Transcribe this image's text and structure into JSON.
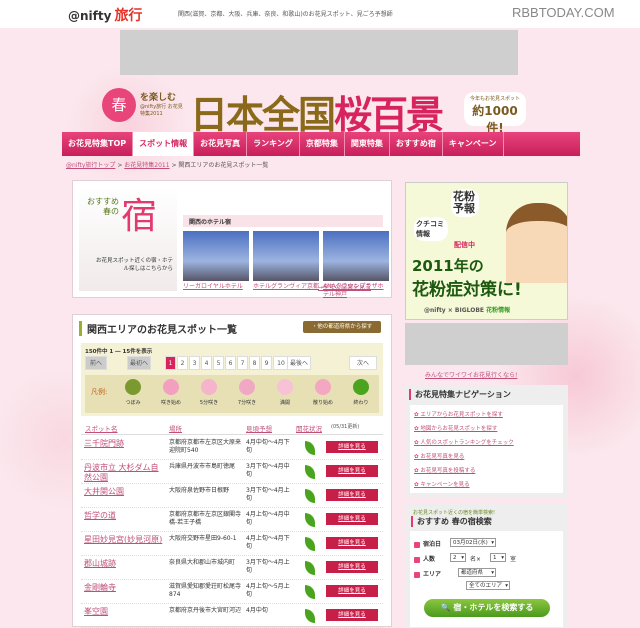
{
  "header": {
    "logo": "@nifty",
    "logo_sub": "旅行",
    "tagline": "関西(滋賀、京都、大阪、兵庫、奈良、和歌山)のお花見スポット、見ごろ予想師",
    "watermark": "RBBTODAY.COM"
  },
  "banner": {
    "flower": "春",
    "enjoy": "を楽しむ",
    "sub": "@nifty旅行 お花見特集2011",
    "title_a": "日本全国",
    "title_b": "桜百景",
    "count_small": "今年もお花見スポット",
    "count_big": "約1000件!"
  },
  "nav": [
    "お花見特集TOP",
    "スポット情報",
    "お花見写真",
    "ランキング",
    "京都特集",
    "関東特集",
    "おすすめ宿",
    "キャンペーン"
  ],
  "breadcrumb": {
    "items": [
      "@nifty旅行トップ",
      "お花見特集2011"
    ],
    "current": "関西エリアのお花見スポット一覧",
    "sep": ">"
  },
  "hotel": {
    "rec_a": "おすすめ春の",
    "rec_k": "宿",
    "rec_desc": "お花見スポット近くの宿・ホテル探しはこちらから",
    "heading": "関西のホテル宿",
    "cards": [
      "リーガロイヤルホテル",
      "ホテルグランヴィア京都",
      "ANAクラウンプラザホテル神戸"
    ],
    "all": "→全ての結果を見る"
  },
  "list": {
    "title": "関西エリアのお花見スポット一覧",
    "other": "・他の都道府県から探す",
    "count": "150件中 1 ― 15件を表示",
    "prev": "前へ",
    "first": "最初へ",
    "pages": [
      "1",
      "2",
      "3",
      "4",
      "5",
      "6",
      "7",
      "8",
      "9",
      "10"
    ],
    "last": "最後へ",
    "next": "次へ",
    "legend_label": "凡例:",
    "legend": [
      "つぼみ",
      "咲き始め",
      "5分咲き",
      "7分咲き",
      "満開",
      "散り始め",
      "終わり"
    ],
    "headers": [
      "スポット名",
      "場所",
      "見頃予想",
      "開花状況"
    ],
    "updated": "(05/31更新)",
    "detail": "詳細を見る",
    "rows": [
      {
        "name": "三千院門跡",
        "place": "京都府京都市左京区大原来迎院町540",
        "time": "4月中旬～4月下旬"
      },
      {
        "name": "丹波市立 大杉ダム自然公園",
        "place": "兵庫県丹波市市島町徳尾",
        "time": "3月下旬～4月中旬"
      },
      {
        "name": "大井関公園",
        "place": "大阪府泉佐野市日根野",
        "time": "3月下旬～4月上旬"
      },
      {
        "name": "哲学の道",
        "place": "京都府京都市左京区銀閣寺橋-若王子橋",
        "time": "4月上旬～4月中旬"
      },
      {
        "name": "星田妙見宮(妙見河原)",
        "place": "大阪府交野市星田9-60-1",
        "time": "4月上旬～4月下旬"
      },
      {
        "name": "郡山城跡",
        "place": "奈良県大和郡山市城内町",
        "time": "3月下旬～4月上旬"
      },
      {
        "name": "金剛輪寺",
        "place": "滋賀県愛知郡愛荘町松尾寺874",
        "time": "4月上旬～5月上旬"
      },
      {
        "name": "峯空園",
        "place": "京都府京丹後市大宮町河辺",
        "time": "4月中旬"
      }
    ]
  },
  "pollen": {
    "a": "花粉予報",
    "b": "クチコミ情報",
    "c": "配信中",
    "d": "2011年の",
    "e": "花粉症対策に!",
    "f1": "@nifty × BIGLOBE",
    "f2": "花粉情報"
  },
  "sidebar": {
    "wai": "みんなでワイワイお花見行くなら!",
    "navi_title": "お花見特集ナビゲーション",
    "navi": [
      "エリアからお花見スポットを探す",
      "地図からお花見スポットを探す",
      "人気のスポットランキングをチェック",
      "お花見写真を見る",
      "お花見写真を投稿する",
      "キャンペーンを見る"
    ],
    "search_sub": "お花見スポット近くの宿を簡単検索!",
    "search_title": "おすすめ 春の宿検索",
    "date_label": "宿泊日",
    "date": "03月02日(水)",
    "people_label": "人数",
    "people": "2",
    "people_unit": "名×",
    "rooms": "1",
    "rooms_unit": "室",
    "area_label": "エリア",
    "pref": "都道府県",
    "area": "全てのエリア",
    "search_btn": "🔍 宿・ホテルを検索する"
  }
}
